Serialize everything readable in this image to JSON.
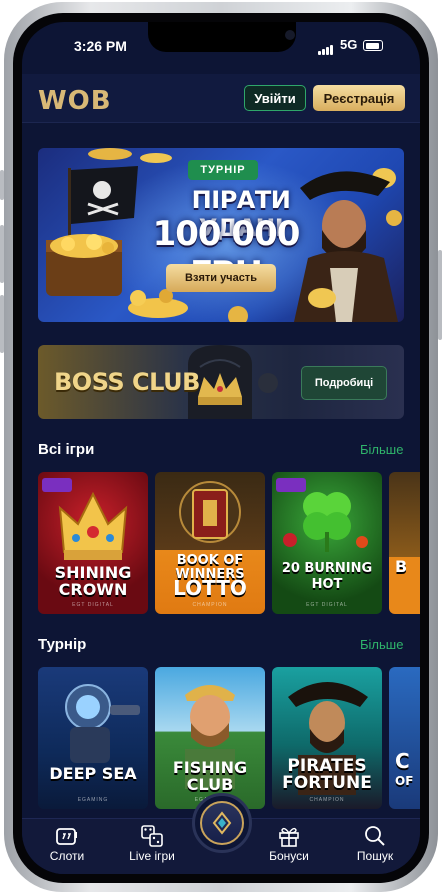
{
  "status_bar": {
    "time": "3:26 PM",
    "network": "5G"
  },
  "header": {
    "logo": "WOB",
    "login_label": "Увійти",
    "register_label": "Реєстрація"
  },
  "promo": {
    "badge": "ТУРНІР",
    "title": "ПІРАТИ УДАЧІ",
    "amount": "100 000 ГРН",
    "button": "Взяти участь"
  },
  "boss_club": {
    "title": "BOSS CLUB",
    "button": "Подробиці"
  },
  "all_games": {
    "title": "Всі ігри",
    "more": "Більше",
    "games": [
      {
        "name_line1": "SHINING",
        "name_line2": "CROWN",
        "provider": "EGT DIGITAL"
      },
      {
        "name_line1": "BOOK OF WINNERS",
        "name_line2": "LOTTO",
        "provider": "CHAMPION"
      },
      {
        "name_line1": "20 BURNING",
        "name_line2": "HOT",
        "provider": "EGT DIGITAL"
      },
      {
        "name_line1": "B",
        "name_line2": "",
        "provider": ""
      }
    ]
  },
  "tournament": {
    "title": "Турнір",
    "more": "Більше",
    "games": [
      {
        "name_line1": "DEEP SEA",
        "name_line2": "",
        "provider": "EGAMING"
      },
      {
        "name_line1": "FISHING",
        "name_line2": "CLUB",
        "provider": "EGAMING"
      },
      {
        "name_line1": "PIRATES",
        "name_line2": "FORTUNE",
        "provider": "CHAMPION"
      },
      {
        "name_line1": "C",
        "name_line2": "OF",
        "provider": ""
      }
    ]
  },
  "bottom_nav": [
    {
      "label": "Слоти",
      "icon": "slots-icon"
    },
    {
      "label": "Live ігри",
      "icon": "dice-icon"
    },
    {
      "label": "Бонуси",
      "icon": "gift-icon"
    },
    {
      "label": "Пошук",
      "icon": "search-icon"
    }
  ],
  "colors": {
    "background": "#0d1535",
    "accent_green": "#2fb56b",
    "accent_gold": "#d9ae5e"
  }
}
